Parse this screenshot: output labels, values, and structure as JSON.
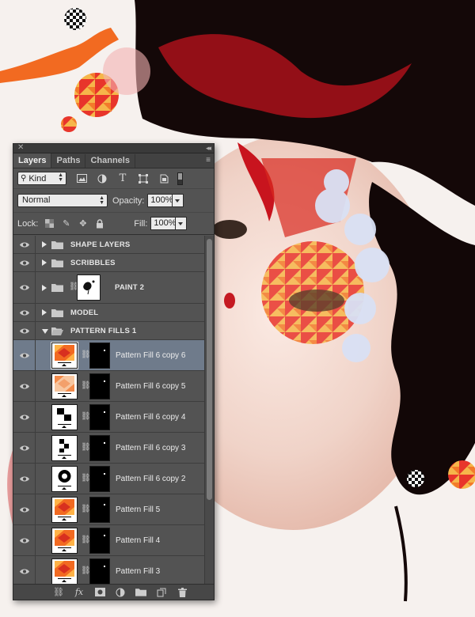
{
  "panel": {
    "tabs": [
      {
        "label": "Layers",
        "active": true
      },
      {
        "label": "Paths",
        "active": false
      },
      {
        "label": "Channels",
        "active": false
      }
    ],
    "filter": {
      "kind_label": "Kind"
    },
    "blend_mode": "Normal",
    "opacity": {
      "label": "Opacity:",
      "value": "100%"
    },
    "lock_label": "Lock:",
    "fill": {
      "label": "Fill:",
      "value": "100%"
    }
  },
  "layers": {
    "groups_top": [
      {
        "label": "SHAPE LAYERS"
      },
      {
        "label": "SCRIBBLES"
      }
    ],
    "paint": {
      "label": "PAINT 2"
    },
    "model": {
      "label": "MODEL"
    },
    "pattern_group": {
      "label": "PATTERN FILLS 1",
      "expanded": true
    },
    "fills": [
      {
        "label": "Pattern Fill 6 copy 6",
        "pattern": "orange-geo",
        "selected": true
      },
      {
        "label": "Pattern Fill 6 copy 5",
        "pattern": "orange-light",
        "selected": false
      },
      {
        "label": "Pattern Fill 6 copy 4",
        "pattern": "checker",
        "selected": false
      },
      {
        "label": "Pattern Fill 6 copy 3",
        "pattern": "checker-small",
        "selected": false
      },
      {
        "label": "Pattern Fill 6 copy 2",
        "pattern": "circle",
        "selected": false
      },
      {
        "label": "Pattern Fill 5",
        "pattern": "orange-geo",
        "selected": false
      },
      {
        "label": "Pattern Fill 4",
        "pattern": "orange-geo",
        "selected": false
      },
      {
        "label": "Pattern Fill 3",
        "pattern": "orange-geo",
        "selected": false
      }
    ]
  },
  "colors": {
    "panel_bg": "#535353",
    "selected_row": "#6f7b8b",
    "accent_red": "#c8141e",
    "pattern_orange": "#f26a21"
  }
}
